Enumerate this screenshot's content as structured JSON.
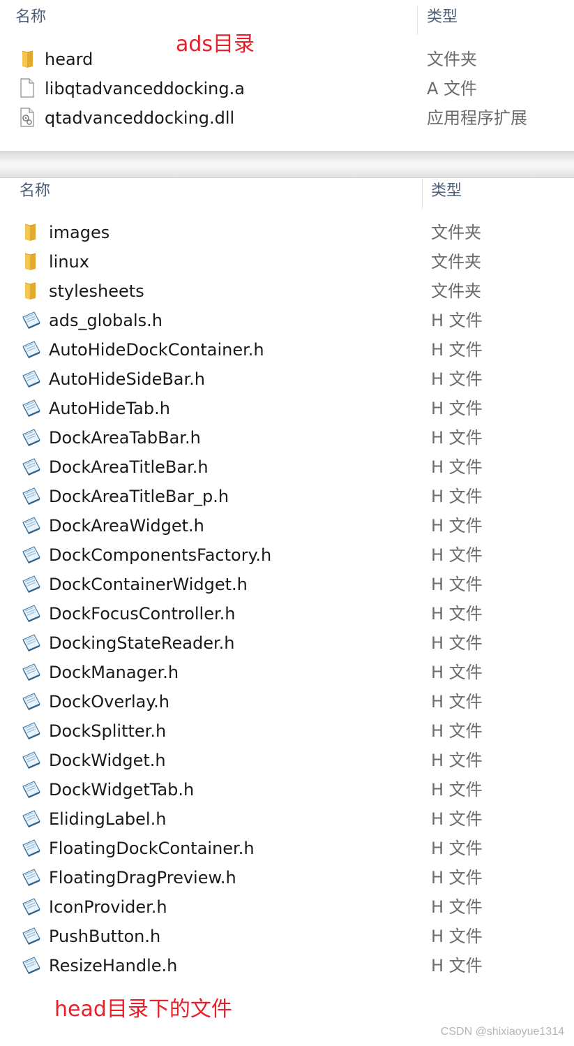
{
  "top_panel": {
    "headers": {
      "name": "名称",
      "type": "类型"
    },
    "annotation": "ads目录",
    "files": [
      {
        "name": "heard",
        "type": "文件夹",
        "icon": "folder-icon"
      },
      {
        "name": "libqtadvanceddocking.a",
        "type": "A 文件",
        "icon": "blank-file-icon"
      },
      {
        "name": "qtadvanceddocking.dll",
        "type": "应用程序扩展",
        "icon": "dll-file-icon"
      }
    ]
  },
  "bottom_panel": {
    "headers": {
      "name": "名称",
      "type": "类型"
    },
    "annotation": "head目录下的文件",
    "files": [
      {
        "name": "images",
        "type": "文件夹",
        "icon": "folder-icon"
      },
      {
        "name": "linux",
        "type": "文件夹",
        "icon": "folder-icon"
      },
      {
        "name": "stylesheets",
        "type": "文件夹",
        "icon": "folder-icon"
      },
      {
        "name": "ads_globals.h",
        "type": "H 文件",
        "icon": "header-file-icon"
      },
      {
        "name": "AutoHideDockContainer.h",
        "type": "H 文件",
        "icon": "header-file-icon"
      },
      {
        "name": "AutoHideSideBar.h",
        "type": "H 文件",
        "icon": "header-file-icon"
      },
      {
        "name": "AutoHideTab.h",
        "type": "H 文件",
        "icon": "header-file-icon"
      },
      {
        "name": "DockAreaTabBar.h",
        "type": "H 文件",
        "icon": "header-file-icon"
      },
      {
        "name": "DockAreaTitleBar.h",
        "type": "H 文件",
        "icon": "header-file-icon"
      },
      {
        "name": "DockAreaTitleBar_p.h",
        "type": "H 文件",
        "icon": "header-file-icon"
      },
      {
        "name": "DockAreaWidget.h",
        "type": "H 文件",
        "icon": "header-file-icon"
      },
      {
        "name": "DockComponentsFactory.h",
        "type": "H 文件",
        "icon": "header-file-icon"
      },
      {
        "name": "DockContainerWidget.h",
        "type": "H 文件",
        "icon": "header-file-icon"
      },
      {
        "name": "DockFocusController.h",
        "type": "H 文件",
        "icon": "header-file-icon"
      },
      {
        "name": "DockingStateReader.h",
        "type": "H 文件",
        "icon": "header-file-icon"
      },
      {
        "name": "DockManager.h",
        "type": "H 文件",
        "icon": "header-file-icon"
      },
      {
        "name": "DockOverlay.h",
        "type": "H 文件",
        "icon": "header-file-icon"
      },
      {
        "name": "DockSplitter.h",
        "type": "H 文件",
        "icon": "header-file-icon"
      },
      {
        "name": "DockWidget.h",
        "type": "H 文件",
        "icon": "header-file-icon"
      },
      {
        "name": "DockWidgetTab.h",
        "type": "H 文件",
        "icon": "header-file-icon"
      },
      {
        "name": "ElidingLabel.h",
        "type": "H 文件",
        "icon": "header-file-icon"
      },
      {
        "name": "FloatingDockContainer.h",
        "type": "H 文件",
        "icon": "header-file-icon"
      },
      {
        "name": "FloatingDragPreview.h",
        "type": "H 文件",
        "icon": "header-file-icon"
      },
      {
        "name": "IconProvider.h",
        "type": "H 文件",
        "icon": "header-file-icon"
      },
      {
        "name": "PushButton.h",
        "type": "H 文件",
        "icon": "header-file-icon"
      },
      {
        "name": "ResizeHandle.h",
        "type": "H 文件",
        "icon": "header-file-icon"
      }
    ]
  },
  "watermark": "CSDN @shixiaoyue1314",
  "colors": {
    "annotation": "#e8202a",
    "header_text": "#4c607a",
    "folder": "#f3c04f"
  }
}
